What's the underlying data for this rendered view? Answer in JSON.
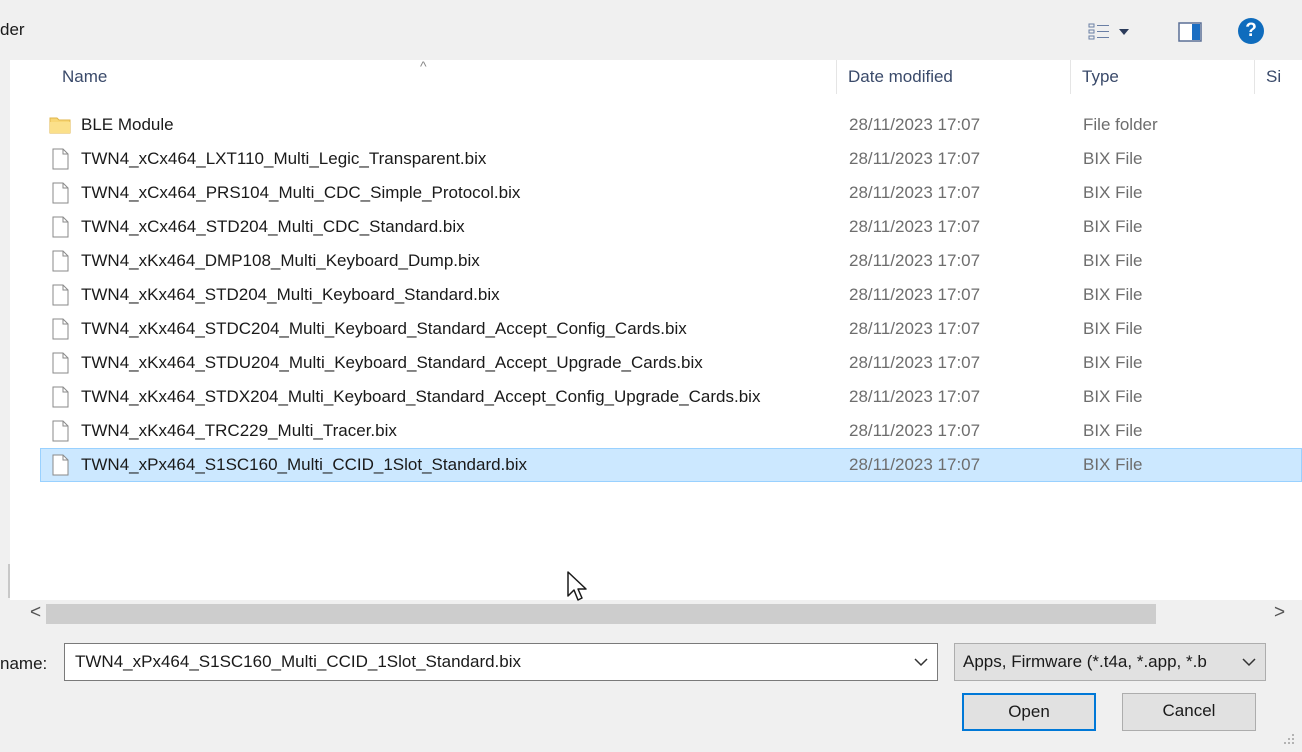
{
  "toolbar": {
    "partial_label": "der",
    "view_icon": "details-view-icon",
    "view_dropdown_icon": "chevron-down-icon",
    "preview_icon": "preview-pane-icon",
    "help_label": "?"
  },
  "columns": {
    "name": "Name",
    "date": "Date modified",
    "type": "Type",
    "size": "Si"
  },
  "files": [
    {
      "name": "BLE Module",
      "date": "28/11/2023 17:07",
      "type": "File folder",
      "icon": "folder-icon"
    },
    {
      "name": "TWN4_xCx464_LXT110_Multi_Legic_Transparent.bix",
      "date": "28/11/2023 17:07",
      "type": "BIX File",
      "icon": "file-icon"
    },
    {
      "name": "TWN4_xCx464_PRS104_Multi_CDC_Simple_Protocol.bix",
      "date": "28/11/2023 17:07",
      "type": "BIX File",
      "icon": "file-icon"
    },
    {
      "name": "TWN4_xCx464_STD204_Multi_CDC_Standard.bix",
      "date": "28/11/2023 17:07",
      "type": "BIX File",
      "icon": "file-icon"
    },
    {
      "name": "TWN4_xKx464_DMP108_Multi_Keyboard_Dump.bix",
      "date": "28/11/2023 17:07",
      "type": "BIX File",
      "icon": "file-icon"
    },
    {
      "name": "TWN4_xKx464_STD204_Multi_Keyboard_Standard.bix",
      "date": "28/11/2023 17:07",
      "type": "BIX File",
      "icon": "file-icon"
    },
    {
      "name": "TWN4_xKx464_STDC204_Multi_Keyboard_Standard_Accept_Config_Cards.bix",
      "date": "28/11/2023 17:07",
      "type": "BIX File",
      "icon": "file-icon"
    },
    {
      "name": "TWN4_xKx464_STDU204_Multi_Keyboard_Standard_Accept_Upgrade_Cards.bix",
      "date": "28/11/2023 17:07",
      "type": "BIX File",
      "icon": "file-icon"
    },
    {
      "name": "TWN4_xKx464_STDX204_Multi_Keyboard_Standard_Accept_Config_Upgrade_Cards.bix",
      "date": "28/11/2023 17:07",
      "type": "BIX File",
      "icon": "file-icon"
    },
    {
      "name": "TWN4_xKx464_TRC229_Multi_Tracer.bix",
      "date": "28/11/2023 17:07",
      "type": "BIX File",
      "icon": "file-icon"
    },
    {
      "name": "TWN4_xPx464_S1SC160_Multi_CCID_1Slot_Standard.bix",
      "date": "28/11/2023 17:07",
      "type": "BIX File",
      "icon": "file-icon",
      "selected": true
    }
  ],
  "scrollbar": {
    "left_arrow": "<",
    "right_arrow": ">"
  },
  "footer": {
    "filename_label": "name:",
    "filename_value": "TWN4_xPx464_S1SC160_Multi_CCID_1Slot_Standard.bix",
    "filter_value": "Apps, Firmware (*.t4a, *.app, *.b",
    "open_label": "Open",
    "cancel_label": "Cancel"
  },
  "colors": {
    "selected_bg": "#cce8ff",
    "selected_border": "#99d1ff",
    "accent": "#0078d7",
    "folder": "#f8d775"
  }
}
